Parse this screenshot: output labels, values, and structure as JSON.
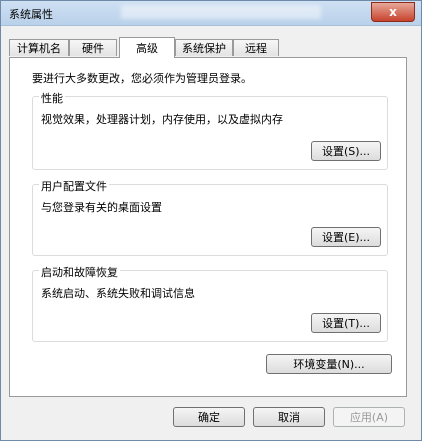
{
  "window": {
    "title": "系统属性",
    "close_glyph": "x"
  },
  "tabs": [
    {
      "label": "计算机名"
    },
    {
      "label": "硬件"
    },
    {
      "label": "高级"
    },
    {
      "label": "系统保护"
    },
    {
      "label": "远程"
    }
  ],
  "notice": "要进行大多数更改，您必须作为管理员登录。",
  "groups": {
    "performance": {
      "title": "性能",
      "desc": "视觉效果，处理器计划，内存使用，以及虚拟内存",
      "button": "设置(S)..."
    },
    "user_profiles": {
      "title": "用户配置文件",
      "desc": "与您登录有关的桌面设置",
      "button": "设置(E)..."
    },
    "startup_recovery": {
      "title": "启动和故障恢复",
      "desc": "系统启动、系统失败和调试信息",
      "button": "设置(T)..."
    }
  },
  "env_button": "环境变量(N)...",
  "footer": {
    "ok": "确定",
    "cancel": "取消",
    "apply": "应用(A)"
  }
}
